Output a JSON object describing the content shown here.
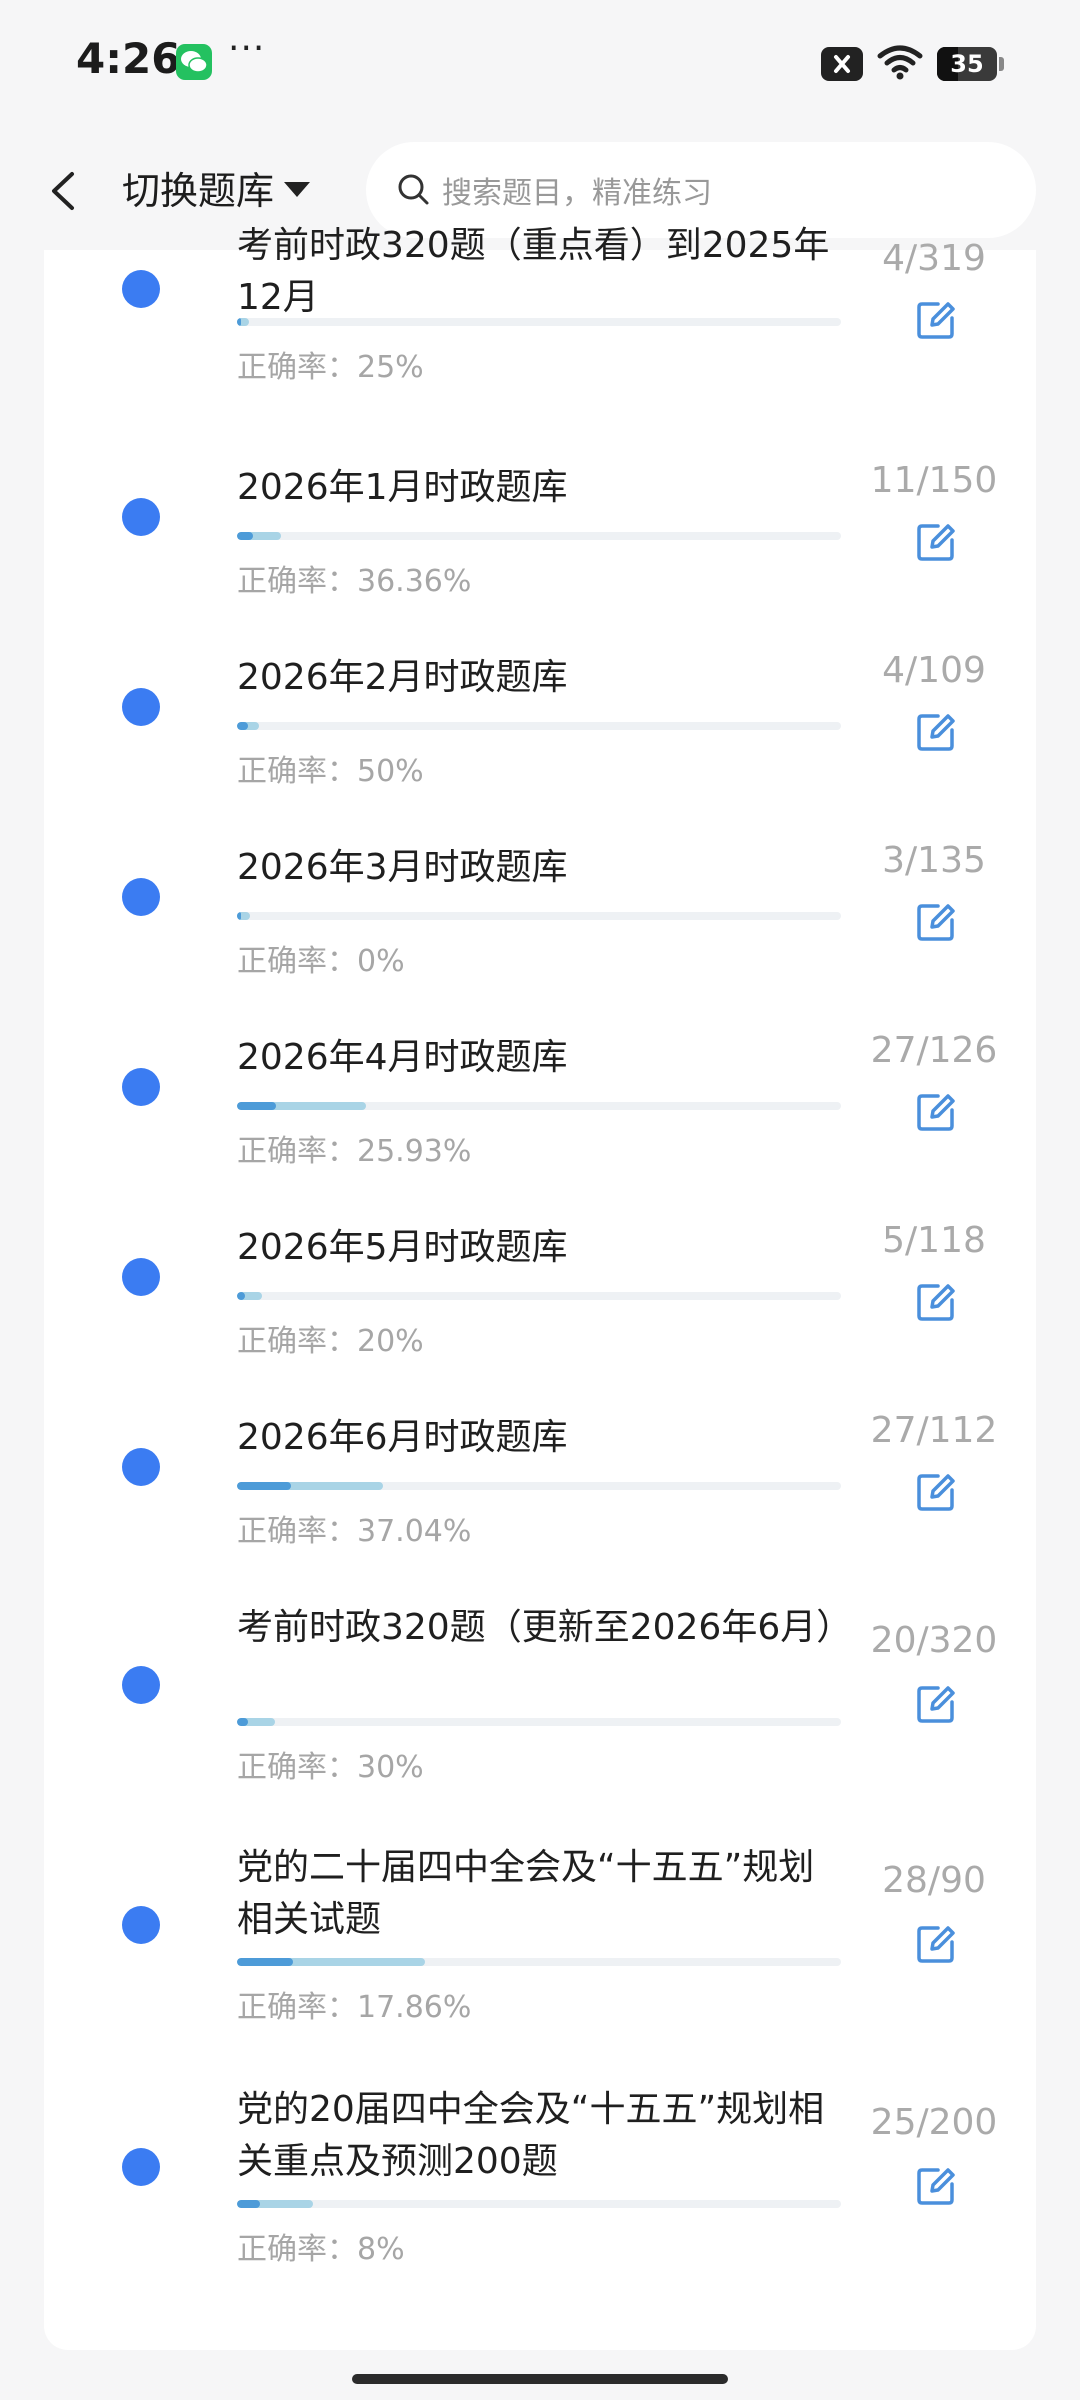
{
  "status_bar": {
    "time": "4:26",
    "battery": "35"
  },
  "header": {
    "switch_label": "切换题库",
    "search_placeholder": "搜索题目，精准练习"
  },
  "accuracy_prefix": "正确率：",
  "items": [
    {
      "title": "考前时政320题（重点看）到2025年12月",
      "ratio": "4/319",
      "accuracy": "25%",
      "progress": 0.0125
    },
    {
      "title": "2026年1月时政题库",
      "ratio": "11/150",
      "accuracy": "36.36%",
      "progress": 0.073
    },
    {
      "title": "2026年2月时政题库",
      "ratio": "4/109",
      "accuracy": "50%",
      "progress": 0.037
    },
    {
      "title": "2026年3月时政题库",
      "ratio": "3/135",
      "accuracy": "0%",
      "progress": 0.022
    },
    {
      "title": "2026年4月时政题库",
      "ratio": "27/126",
      "accuracy": "25.93%",
      "progress": 0.214
    },
    {
      "title": "2026年5月时政题库",
      "ratio": "5/118",
      "accuracy": "20%",
      "progress": 0.042
    },
    {
      "title": "2026年6月时政题库",
      "ratio": "27/112",
      "accuracy": "37.04%",
      "progress": 0.241
    },
    {
      "title": "考前时政320题（更新至2026年6月）",
      "ratio": "20/320",
      "accuracy": "30%",
      "progress": 0.0625
    },
    {
      "title": "党的二十届四中全会及“十五五”规划相关试题",
      "ratio": "28/90",
      "accuracy": "17.86%",
      "progress": 0.311
    },
    {
      "title": "党的20届四中全会及“十五五”规划相关重点及预测200题",
      "ratio": "25/200",
      "accuracy": "8%",
      "progress": 0.125
    }
  ],
  "colors": {
    "dot": "#3b7cf2",
    "edit_icon": "#4a8fdc",
    "bar": "#a9d4e6",
    "bar_done": "#4d9bd8"
  }
}
